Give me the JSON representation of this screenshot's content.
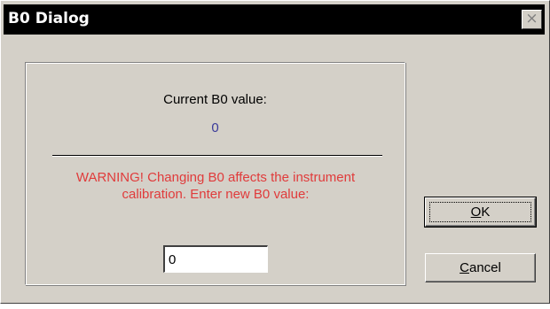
{
  "window": {
    "title": "B0 Dialog",
    "close_glyph": "×"
  },
  "panel": {
    "current_label": "Current B0 value:",
    "current_value": "0",
    "warning_line1": "WARNING! Changing B0 affects the instrument",
    "warning_line2": "calibration. Enter new B0 value:",
    "input_value": "0"
  },
  "buttons": {
    "ok": {
      "mnemonic": "O",
      "rest": "K"
    },
    "cancel": {
      "mnemonic": "C",
      "rest": "ancel"
    }
  },
  "colors": {
    "titlebar": "#000000",
    "dialog_face": "#d4d0c8",
    "current_value_text": "#3b3b9a",
    "warning_text": "#e03b3b"
  },
  "icons": {
    "close": "close-icon"
  }
}
